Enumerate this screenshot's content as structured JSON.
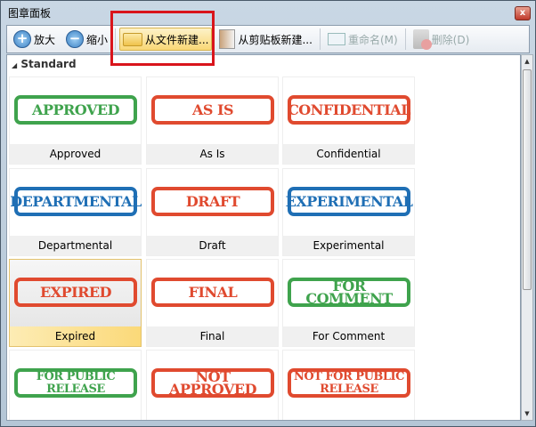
{
  "window": {
    "title": "图章面板",
    "close": "x"
  },
  "toolbar": {
    "zoom_in": "放大",
    "zoom_out": "缩小",
    "new_from_file": "从文件新建...",
    "new_from_clipboard": "从剪贴板新建...",
    "rename": "重命名(M)",
    "delete": "删除(D)"
  },
  "group": {
    "label": "Standard",
    "arrow": "◢"
  },
  "stamps": [
    {
      "text": "APPROVED",
      "label": "Approved",
      "color": "#3fa34d"
    },
    {
      "text": "AS IS",
      "label": "As Is",
      "color": "#e04a2f"
    },
    {
      "text": "CONFIDENTIAL",
      "label": "Confidential",
      "color": "#e04a2f"
    },
    {
      "text": "DEPARTMENTAL",
      "label": "Departmental",
      "color": "#1f6fb5"
    },
    {
      "text": "DRAFT",
      "label": "Draft",
      "color": "#e04a2f"
    },
    {
      "text": "EXPERIMENTAL",
      "label": "Experimental",
      "color": "#1f6fb5"
    },
    {
      "text": "EXPIRED",
      "label": "Expired",
      "color": "#e04a2f",
      "selected": true
    },
    {
      "text": "FINAL",
      "label": "Final",
      "color": "#e04a2f"
    },
    {
      "text": "FOR COMMENT",
      "label": "For Comment",
      "color": "#3fa34d"
    },
    {
      "text": "FOR PUBLIC RELEASE",
      "label": "",
      "color": "#3fa34d"
    },
    {
      "text": "NOT APPROVED",
      "label": "",
      "color": "#e04a2f"
    },
    {
      "text": "NOT FOR PUBLIC RELEASE",
      "label": "",
      "color": "#e04a2f"
    }
  ]
}
